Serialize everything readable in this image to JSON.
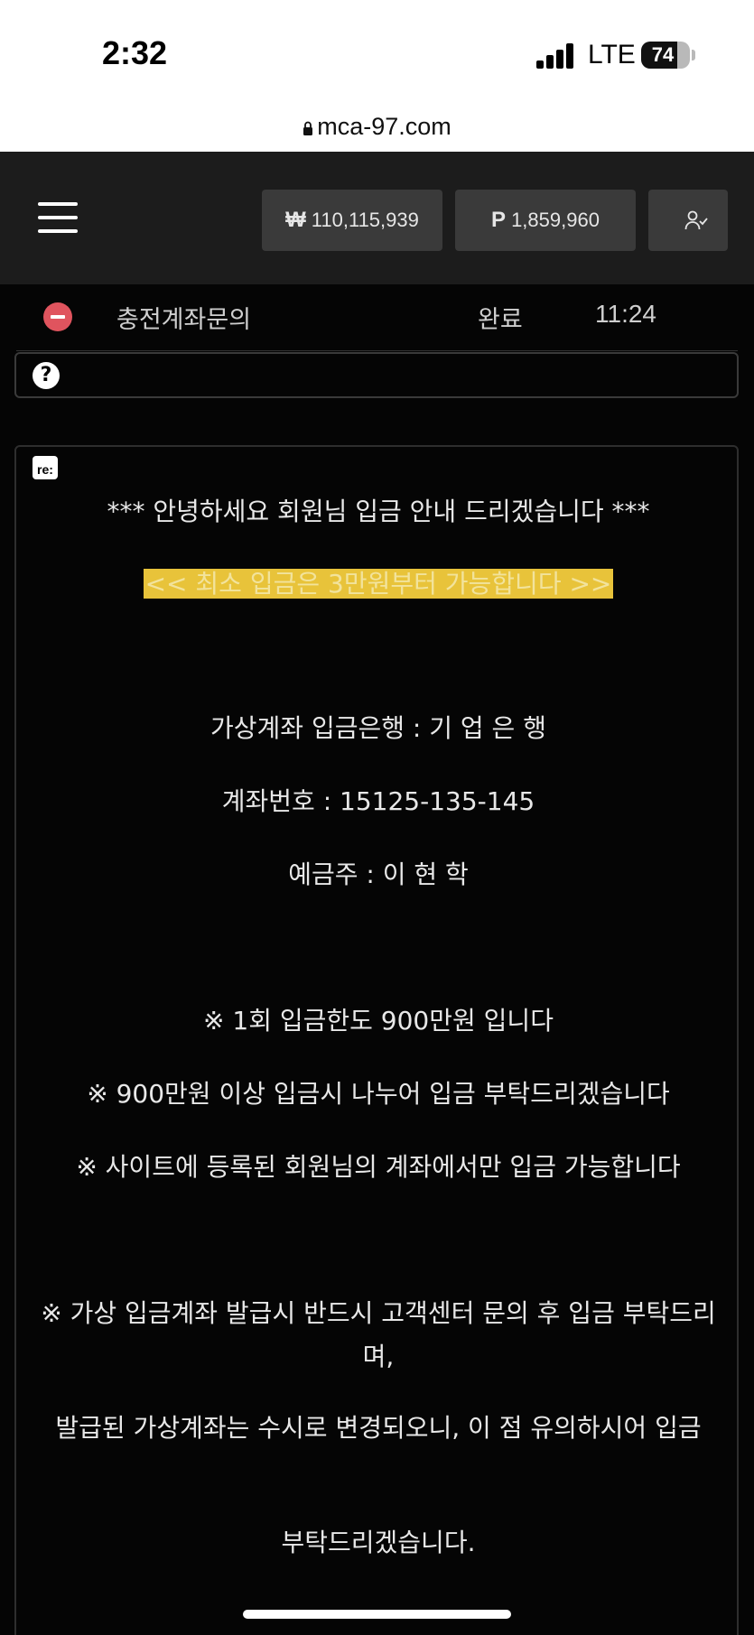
{
  "status_bar": {
    "time": "2:32",
    "network": "LTE",
    "battery": "74"
  },
  "browser": {
    "url": "mca-97.com"
  },
  "header": {
    "won_symbol": "₩",
    "won_balance": "110,115,939",
    "point_symbol": "P",
    "point_balance": "1,859,960"
  },
  "inquiry": {
    "title": "충전계좌문의",
    "status": "완료",
    "time": "11:24"
  },
  "reply": {
    "badge": "re:",
    "greeting": "*** 안녕하세요 회원님 입금 안내 드리겠습니다 ***",
    "min_deposit": "<< 최소 입금은 3만원부터 가능합니다 >>",
    "bank": "가상계좌 입금은행 : 기 업 은 행",
    "account_number": "계좌번호 : 15125-135-145",
    "holder": "예금주 : 이 현 학",
    "note1": "※ 1회 입금한도 900만원 입니다",
    "note2": "※ 900만원 이상 입금시 나누어 입금 부탁드리겠습니다",
    "note3": "※ 사이트에 등록된 회원님의 계좌에서만 입금 가능합니다",
    "note4": "※ 가상 입금계좌 발급시 반드시 고객센터 문의 후 입금 부탁드리며,",
    "note5": "발급된 가상계좌는 수시로 변경되오니, 이 점 유의하시어 입금",
    "note6": "부탁드리겠습니다."
  }
}
